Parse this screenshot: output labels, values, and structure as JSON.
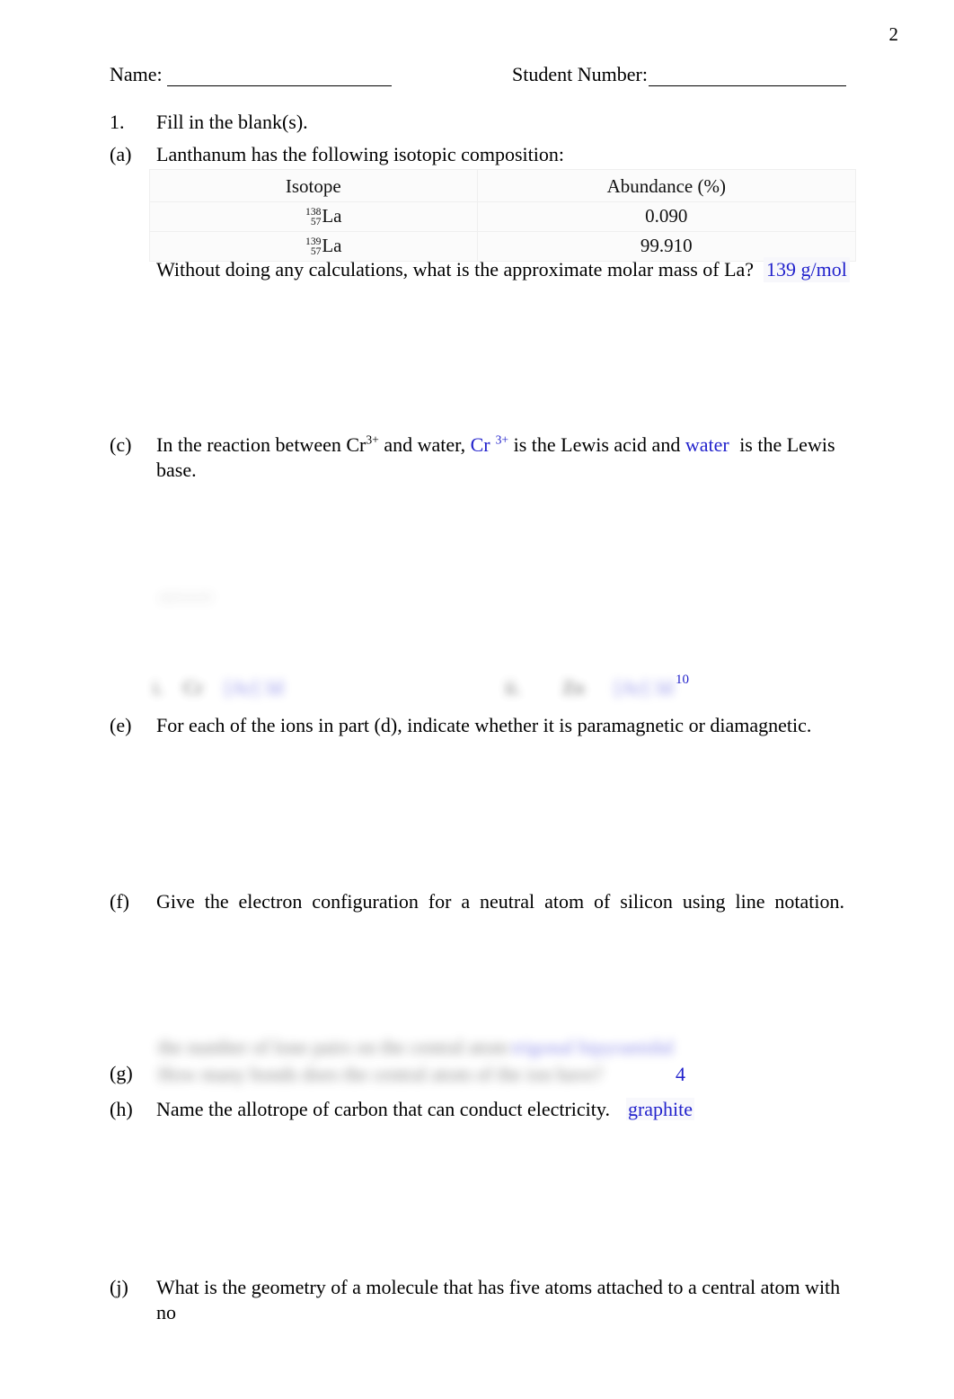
{
  "document": {
    "page_number": "2",
    "accent_answer_color": "#2222cc",
    "text_color": "#000000"
  },
  "header": {
    "name_label": "Name:",
    "student_number_label": "Student Number:"
  },
  "question_1": {
    "marker": "1.",
    "text": "Fill in the blank(s)."
  },
  "part_a": {
    "marker": "(a)",
    "text": "Lanthanum has the following isotopic composition:",
    "table": {
      "columns": [
        "Isotope",
        "Abundance (%)"
      ],
      "rows": [
        {
          "mass_number": "138",
          "atomic_number": "57",
          "symbol": "La",
          "abundance": "0.090"
        },
        {
          "mass_number": "139",
          "atomic_number": "57",
          "symbol": "La",
          "abundance": "99.910"
        }
      ]
    },
    "follow_up_question": "Without doing any calculations, what is the approximate molar mass of La?",
    "answer": "139 g/mol"
  },
  "part_c": {
    "marker": "(c)",
    "text_before": "In the reaction between Cr",
    "charge_1": "3+",
    "text_mid_1": " and water, ",
    "answer_1": "Cr",
    "answer_1_charge": "3+",
    "text_mid_2": " is the Lewis acid and ",
    "answer_2": "water",
    "text_after": " is the Lewis base."
  },
  "part_d_blurred": {
    "marker_left": "i.",
    "marker_right": "ii.",
    "redacted_label_left": "Cr",
    "redacted_answer_left": "[Ar] 3d",
    "redacted_label_right": "Zn",
    "redacted_answer_right": "[Ar] 3d",
    "visible_superscript": "10"
  },
  "part_e": {
    "marker": "(e)",
    "text": "For each of the ions in part (d), indicate whether it is paramagnetic or diamagnetic."
  },
  "part_f": {
    "marker": "(f)",
    "text": "Give the electron configuration for a neutral atom of silicon using line notation."
  },
  "part_g": {
    "marker": "(g)",
    "redacted_text": "How many bonds does the central atom of the ion have?",
    "answer": "4"
  },
  "part_h": {
    "marker": "(h)",
    "text": "Name the allotrope of carbon that can conduct electricity.",
    "answer": "graphite"
  },
  "part_j": {
    "marker": "(j)",
    "text": "What is the geometry of a molecule that has five atoms attached to a central atom with no"
  },
  "redacted_blocks": {
    "above_g_question": "the number of lone pairs on the central atom",
    "above_g_answer": "trigonal bipyramidal",
    "faint_smudge": "answer"
  }
}
